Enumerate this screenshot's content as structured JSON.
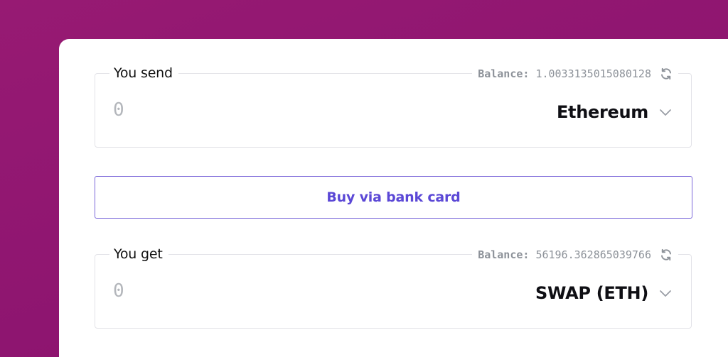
{
  "send": {
    "label": "You send",
    "balance_label": "Balance:",
    "balance_value": "1.0033135015080128",
    "amount_placeholder": "0",
    "currency": "Ethereum"
  },
  "buy_button": {
    "label": "Buy via bank card"
  },
  "get": {
    "label": "You get",
    "balance_label": "Balance:",
    "balance_value": "56196.362865039766",
    "amount_placeholder": "0",
    "currency": "SWAP (ETH)"
  },
  "colors": {
    "background": "#971a73",
    "accent": "#5b48d6",
    "border": "#e3e3e8",
    "muted_text": "#8d9299"
  },
  "icons": {
    "refresh": "refresh-icon",
    "dropdown": "chevron-down-icon"
  }
}
